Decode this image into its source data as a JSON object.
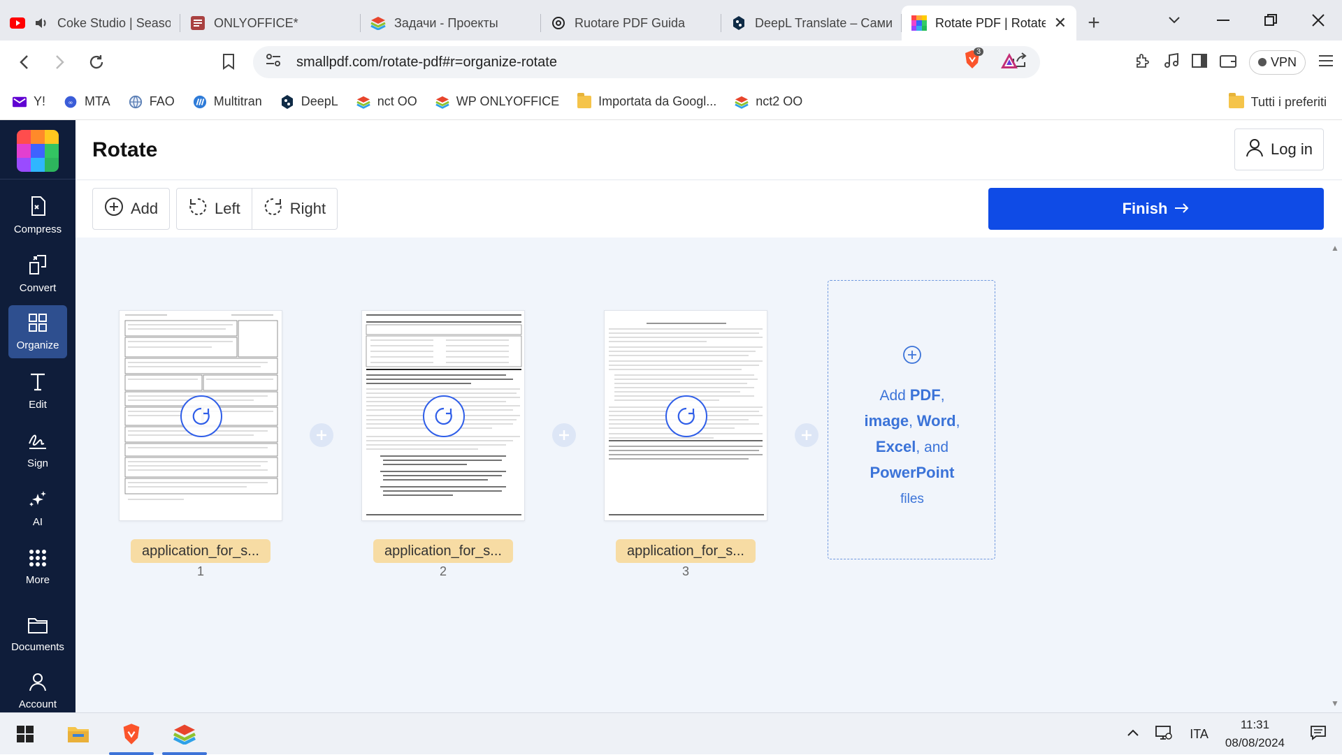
{
  "browser": {
    "tabs": [
      {
        "title": "Coke Studio | Season",
        "favicon": "youtube-icon",
        "audio": true
      },
      {
        "title": "ONLYOFFICE*",
        "favicon": "onlyoffice-doc-icon"
      },
      {
        "title": "Задачи - Проекты",
        "favicon": "layers-icon"
      },
      {
        "title": "Ruotare PDF Guida",
        "favicon": "openai-icon"
      },
      {
        "title": "DeepL Translate – Сами",
        "favicon": "deepl-icon"
      },
      {
        "title": "Rotate PDF | Rotate",
        "favicon": "smallpdf-icon",
        "active": true
      }
    ],
    "url": "smallpdf.com/rotate-pdf#r=organize-rotate",
    "brave_badge": "3",
    "vpn_label": "VPN",
    "bookmarks": [
      {
        "label": "Y!",
        "icon": "yahoo-mail-icon"
      },
      {
        "label": "MTA",
        "icon": "mta-icon"
      },
      {
        "label": "FAO",
        "icon": "globe-icon"
      },
      {
        "label": "Multitran",
        "icon": "multitran-icon"
      },
      {
        "label": "DeepL",
        "icon": "deepl-icon"
      },
      {
        "label": "nct OO",
        "icon": "layers-icon"
      },
      {
        "label": "WP ONLYOFFICE",
        "icon": "layers-icon"
      },
      {
        "label": "Importata da Googl...",
        "icon": "folder-icon"
      },
      {
        "label": "nct2 OO",
        "icon": "layers-icon"
      }
    ],
    "bookmarks_right": "Tutti i preferiti"
  },
  "sidebar": {
    "items": [
      {
        "label": "Compress",
        "icon": "compress-icon"
      },
      {
        "label": "Convert",
        "icon": "convert-icon"
      },
      {
        "label": "Organize",
        "icon": "grid-icon",
        "active": true
      },
      {
        "label": "Edit",
        "icon": "text-edit-icon"
      },
      {
        "label": "Sign",
        "icon": "signature-icon"
      },
      {
        "label": "AI",
        "icon": "sparkle-icon"
      },
      {
        "label": "More",
        "icon": "dots-grid-icon"
      },
      {
        "label": "Documents",
        "icon": "folder-icon"
      },
      {
        "label": "Account",
        "icon": "user-icon"
      }
    ]
  },
  "header": {
    "title": "Rotate",
    "login_label": "Log in"
  },
  "actions": {
    "add_label": "Add",
    "left_label": "Left",
    "right_label": "Right",
    "finish_label": "Finish"
  },
  "pages": [
    {
      "file_name": "application_for_s...",
      "number": "1"
    },
    {
      "file_name": "application_for_s...",
      "number": "2"
    },
    {
      "file_name": "application_for_s...",
      "number": "3"
    }
  ],
  "add_files": {
    "add": "Add",
    "pdf": "PDF",
    "image": "image",
    "word": "Word",
    "excel": "Excel",
    "and": "and",
    "powerpoint": "PowerPoint",
    "files": "files"
  },
  "taskbar": {
    "language": "ITA",
    "time": "11:31",
    "date": "08/08/2024"
  },
  "colors": {
    "accent": "#0f4be6",
    "sidebar_bg": "#0f1d3a",
    "sidebar_active": "#2e4f8f",
    "filename_badge": "#f7dca4",
    "workarea_bg": "#f1f5fb"
  }
}
